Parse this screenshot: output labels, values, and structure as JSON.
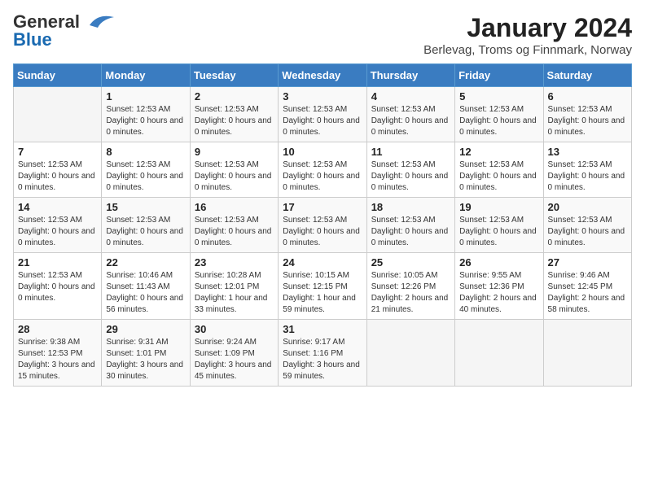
{
  "logo": {
    "general": "General",
    "blue": "Blue"
  },
  "title": "January 2024",
  "subtitle": "Berlevag, Troms og Finnmark, Norway",
  "weekdays": [
    "Sunday",
    "Monday",
    "Tuesday",
    "Wednesday",
    "Thursday",
    "Friday",
    "Saturday"
  ],
  "weeks": [
    [
      {
        "day": "",
        "info": ""
      },
      {
        "day": "1",
        "info": "Sunset: 12:53 AM\nDaylight: 0 hours and 0 minutes."
      },
      {
        "day": "2",
        "info": "Sunset: 12:53 AM\nDaylight: 0 hours and 0 minutes."
      },
      {
        "day": "3",
        "info": "Sunset: 12:53 AM\nDaylight: 0 hours and 0 minutes."
      },
      {
        "day": "4",
        "info": "Sunset: 12:53 AM\nDaylight: 0 hours and 0 minutes."
      },
      {
        "day": "5",
        "info": "Sunset: 12:53 AM\nDaylight: 0 hours and 0 minutes."
      },
      {
        "day": "6",
        "info": "Sunset: 12:53 AM\nDaylight: 0 hours and 0 minutes."
      }
    ],
    [
      {
        "day": "7",
        "info": "Sunset: 12:53 AM\nDaylight: 0 hours and 0 minutes."
      },
      {
        "day": "8",
        "info": "Sunset: 12:53 AM\nDaylight: 0 hours and 0 minutes."
      },
      {
        "day": "9",
        "info": "Sunset: 12:53 AM\nDaylight: 0 hours and 0 minutes."
      },
      {
        "day": "10",
        "info": "Sunset: 12:53 AM\nDaylight: 0 hours and 0 minutes."
      },
      {
        "day": "11",
        "info": "Sunset: 12:53 AM\nDaylight: 0 hours and 0 minutes."
      },
      {
        "day": "12",
        "info": "Sunset: 12:53 AM\nDaylight: 0 hours and 0 minutes."
      },
      {
        "day": "13",
        "info": "Sunset: 12:53 AM\nDaylight: 0 hours and 0 minutes."
      }
    ],
    [
      {
        "day": "14",
        "info": "Sunset: 12:53 AM\nDaylight: 0 hours and 0 minutes."
      },
      {
        "day": "15",
        "info": "Sunset: 12:53 AM\nDaylight: 0 hours and 0 minutes."
      },
      {
        "day": "16",
        "info": "Sunset: 12:53 AM\nDaylight: 0 hours and 0 minutes."
      },
      {
        "day": "17",
        "info": "Sunset: 12:53 AM\nDaylight: 0 hours and 0 minutes."
      },
      {
        "day": "18",
        "info": "Sunset: 12:53 AM\nDaylight: 0 hours and 0 minutes."
      },
      {
        "day": "19",
        "info": "Sunset: 12:53 AM\nDaylight: 0 hours and 0 minutes."
      },
      {
        "day": "20",
        "info": "Sunset: 12:53 AM\nDaylight: 0 hours and 0 minutes."
      }
    ],
    [
      {
        "day": "21",
        "info": "Sunset: 12:53 AM\nDaylight: 0 hours and 0 minutes."
      },
      {
        "day": "22",
        "info": "Sunrise: 10:46 AM\nSunset: 11:43 AM\nDaylight: 0 hours and 56 minutes."
      },
      {
        "day": "23",
        "info": "Sunrise: 10:28 AM\nSunset: 12:01 PM\nDaylight: 1 hour and 33 minutes."
      },
      {
        "day": "24",
        "info": "Sunrise: 10:15 AM\nSunset: 12:15 PM\nDaylight: 1 hour and 59 minutes."
      },
      {
        "day": "25",
        "info": "Sunrise: 10:05 AM\nSunset: 12:26 PM\nDaylight: 2 hours and 21 minutes."
      },
      {
        "day": "26",
        "info": "Sunrise: 9:55 AM\nSunset: 12:36 PM\nDaylight: 2 hours and 40 minutes."
      },
      {
        "day": "27",
        "info": "Sunrise: 9:46 AM\nSunset: 12:45 PM\nDaylight: 2 hours and 58 minutes."
      }
    ],
    [
      {
        "day": "28",
        "info": "Sunrise: 9:38 AM\nSunset: 12:53 PM\nDaylight: 3 hours and 15 minutes."
      },
      {
        "day": "29",
        "info": "Sunrise: 9:31 AM\nSunset: 1:01 PM\nDaylight: 3 hours and 30 minutes."
      },
      {
        "day": "30",
        "info": "Sunrise: 9:24 AM\nSunset: 1:09 PM\nDaylight: 3 hours and 45 minutes."
      },
      {
        "day": "31",
        "info": "Sunrise: 9:17 AM\nSunset: 1:16 PM\nDaylight: 3 hours and 59 minutes."
      },
      {
        "day": "",
        "info": ""
      },
      {
        "day": "",
        "info": ""
      },
      {
        "day": "",
        "info": ""
      }
    ]
  ]
}
